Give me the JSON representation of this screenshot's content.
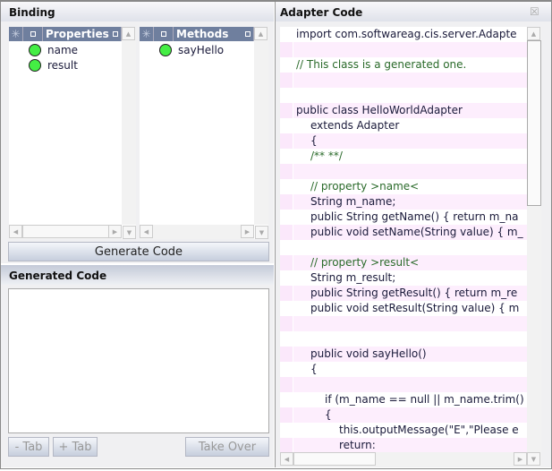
{
  "binding": {
    "title": "Binding",
    "properties": {
      "header": "Properties",
      "items": [
        "name",
        "result"
      ]
    },
    "methods": {
      "header": "Methods",
      "items": [
        "sayHello"
      ]
    },
    "generate_label": "Generate Code"
  },
  "generated": {
    "title": "Generated Code",
    "value": "",
    "minus_tab": "- Tab",
    "plus_tab": "+ Tab",
    "take_over": "Take Over"
  },
  "adapter": {
    "title": "Adapter Code",
    "lines": [
      {
        "t": "import com.softwareag.cis.server.Adapte",
        "i": 0
      },
      {
        "t": "",
        "i": 0
      },
      {
        "t": "// This class is a generated one.",
        "i": 0,
        "c": 1
      },
      {
        "t": "",
        "i": 0
      },
      {
        "t": "",
        "i": 0
      },
      {
        "t": "public class HelloWorldAdapter",
        "i": 0
      },
      {
        "t": "extends Adapter",
        "i": 1
      },
      {
        "t": "{",
        "i": 1
      },
      {
        "t": "/** **/",
        "i": 1,
        "c": 1
      },
      {
        "t": "",
        "i": 0
      },
      {
        "t": "// property >name<",
        "i": 1,
        "c": 1
      },
      {
        "t": "String m_name;",
        "i": 1
      },
      {
        "t": "public String getName() { return m_na",
        "i": 1
      },
      {
        "t": "public void setName(String value) { m_",
        "i": 1
      },
      {
        "t": "",
        "i": 0
      },
      {
        "t": "// property >result<",
        "i": 1,
        "c": 1
      },
      {
        "t": "String m_result;",
        "i": 1
      },
      {
        "t": "public String getResult() { return m_re",
        "i": 1
      },
      {
        "t": "public void setResult(String value) { m",
        "i": 1
      },
      {
        "t": "",
        "i": 0
      },
      {
        "t": "",
        "i": 0
      },
      {
        "t": "public void sayHello()",
        "i": 1
      },
      {
        "t": "{",
        "i": 1
      },
      {
        "t": "",
        "i": 0
      },
      {
        "t": "if (m_name == null || m_name.trim()",
        "i": 2
      },
      {
        "t": "{",
        "i": 2
      },
      {
        "t": "this.outputMessage(\"E\",\"Please e",
        "i": 3
      },
      {
        "t": "return:",
        "i": 3
      }
    ]
  },
  "colors": {
    "header_blue": "#6f7f9e",
    "status_green": "#44ee44",
    "row_pink": "#fdeefd",
    "comment": "#2a6a2a"
  }
}
